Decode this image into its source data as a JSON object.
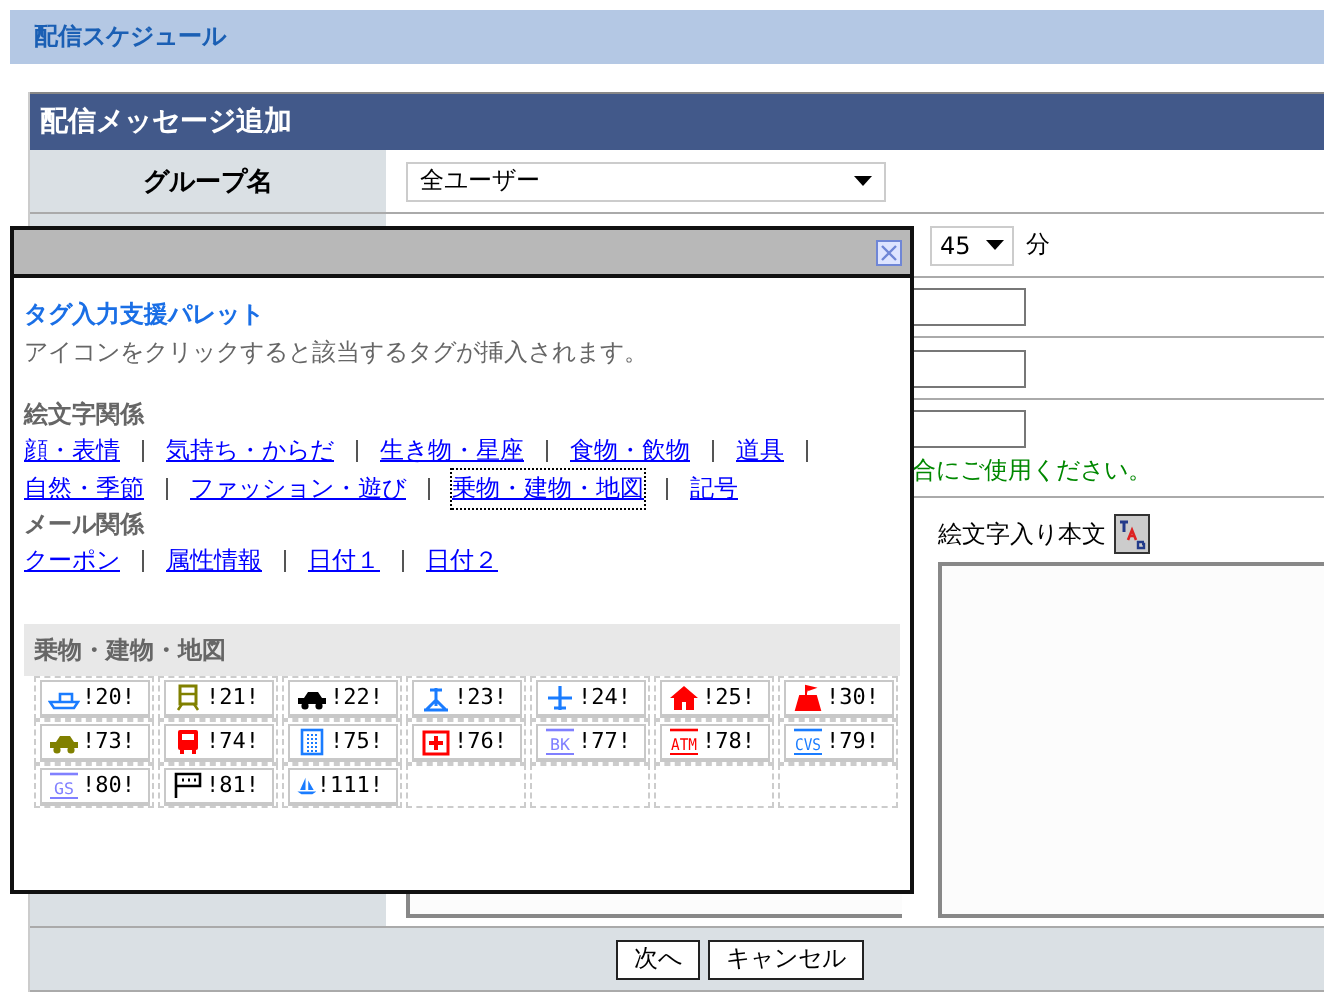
{
  "header": {
    "title": "配信スケジュール"
  },
  "panel": {
    "title": "配信メッセージ追加",
    "group_row": {
      "label": "グループ名",
      "value": "全ユーザー"
    },
    "time_row": {
      "minute": "45",
      "unit": "分"
    },
    "note": "合にご使用ください。",
    "body_label": "絵文字入り本文",
    "buttons": [
      "次へ",
      "キャンセル"
    ]
  },
  "palette": {
    "title": "タグ入力支援パレット",
    "description": "アイコンをクリックすると該当するタグが挿入されます。",
    "groups": [
      {
        "heading": "絵文字関係",
        "links": [
          {
            "label": "顔・表情",
            "selected": false
          },
          {
            "label": "気持ち・からだ",
            "selected": false
          },
          {
            "label": "生き物・星座",
            "selected": false
          },
          {
            "label": "食物・飲物",
            "selected": false
          },
          {
            "label": "道具",
            "selected": false
          },
          {
            "label": "自然・季節",
            "selected": false
          },
          {
            "label": "ファッション・遊び",
            "selected": false
          },
          {
            "label": "乗物・建物・地図",
            "selected": true
          },
          {
            "label": "記号",
            "selected": false
          }
        ]
      },
      {
        "heading": "メール関係",
        "links": [
          {
            "label": "クーポン",
            "selected": false
          },
          {
            "label": "属性情報",
            "selected": false
          },
          {
            "label": "日付１",
            "selected": false
          },
          {
            "label": "日付２",
            "selected": false
          }
        ]
      }
    ],
    "section": {
      "title": "乗物・建物・地図",
      "items": [
        {
          "code": "!20!",
          "kind": "ship",
          "color": "#1a7cff"
        },
        {
          "code": "!21!",
          "kind": "train",
          "color": "#808000"
        },
        {
          "code": "!22!",
          "kind": "car",
          "color": "#000000"
        },
        {
          "code": "!23!",
          "kind": "ride",
          "color": "#1a7cff"
        },
        {
          "code": "!24!",
          "kind": "plane",
          "color": "#1a7cff"
        },
        {
          "code": "!25!",
          "kind": "house",
          "color": "#ff0000"
        },
        {
          "code": "!30!",
          "kind": "castle",
          "color": "#ff0000"
        },
        {
          "code": "!73!",
          "kind": "car",
          "color": "#808000"
        },
        {
          "code": "!74!",
          "kind": "bus",
          "color": "#ff0000"
        },
        {
          "code": "!75!",
          "kind": "building",
          "color": "#1a7cff"
        },
        {
          "code": "!76!",
          "kind": "hospital",
          "color": "#ff0000"
        },
        {
          "code": "!77!",
          "kind": "sign",
          "color": "#8080ff",
          "sign": "BK"
        },
        {
          "code": "!78!",
          "kind": "sign",
          "color": "#ff0000",
          "sign": "ATM"
        },
        {
          "code": "!79!",
          "kind": "sign",
          "color": "#1a7cff",
          "sign": "CVS"
        },
        {
          "code": "!80!",
          "kind": "sign",
          "color": "#8080ff",
          "sign": "GS"
        },
        {
          "code": "!81!",
          "kind": "flag",
          "color": "#000000"
        },
        {
          "code": "!111!",
          "kind": "sailboat",
          "color": "#1a7cff"
        }
      ]
    }
  }
}
